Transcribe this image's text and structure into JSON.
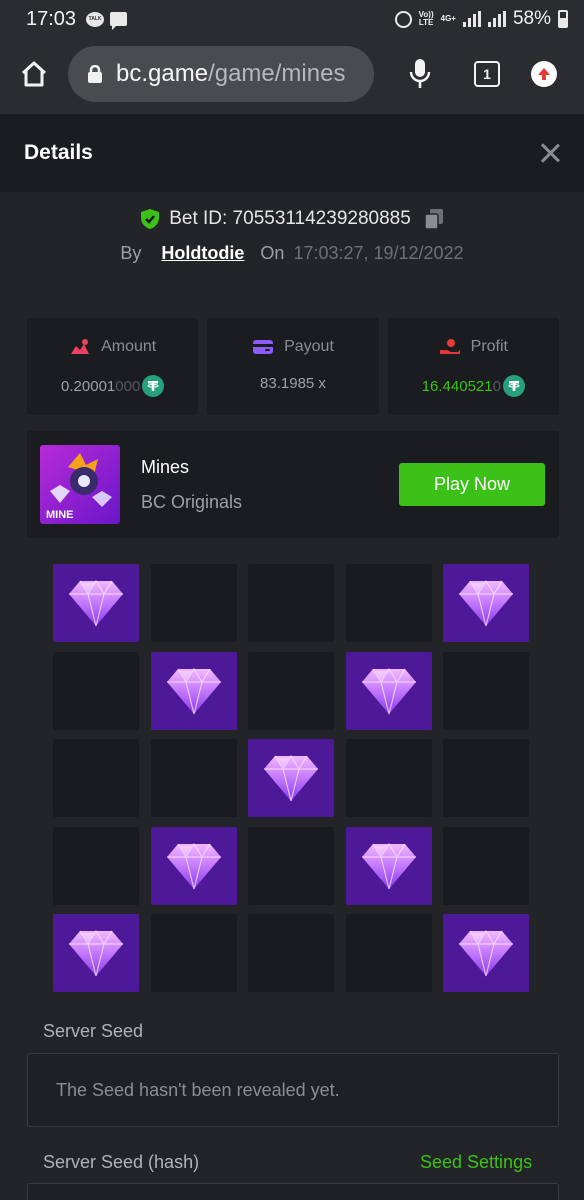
{
  "status_bar": {
    "time": "17:03",
    "network_top": "Vo))",
    "network_bottom": "LTE",
    "network_gen": "4G+",
    "battery": "58%"
  },
  "browser": {
    "url_host": "bc.game",
    "url_path": "/game/mines",
    "tab_count": "1"
  },
  "details": {
    "title": "Details"
  },
  "bet": {
    "id_text": "Bet ID: 70553114239280885",
    "by_label": "By",
    "user": "Holdtodie",
    "on_label": "On",
    "datetime": "17:03:27, 19/12/2022"
  },
  "stats": {
    "amount": {
      "label": "Amount",
      "value_main": "0.20001",
      "value_dim": "000",
      "icon_color": "#ed4163"
    },
    "payout": {
      "label": "Payout",
      "value": "83.1985 x",
      "icon_color": "#8b5cf6"
    },
    "profit": {
      "label": "Profit",
      "value_main": "16.440521",
      "value_dim": "0",
      "icon_color": "#e53935"
    }
  },
  "game": {
    "name": "Mines",
    "provider": "BC Originals",
    "thumb_label": "MINE",
    "play_label": "Play Now"
  },
  "grid": {
    "tiles": [
      "gem",
      "empty",
      "empty",
      "empty",
      "gem",
      "empty",
      "gem",
      "empty",
      "gem",
      "empty",
      "empty",
      "empty",
      "gem",
      "empty",
      "empty",
      "empty",
      "gem",
      "empty",
      "gem",
      "empty",
      "gem",
      "empty",
      "empty",
      "empty",
      "gem"
    ]
  },
  "seeds": {
    "server_seed_label": "Server Seed",
    "server_seed_value": "The Seed hasn't been revealed yet.",
    "server_hash_label": "Server Seed (hash)",
    "seed_settings_label": "Seed Settings"
  },
  "colors": {
    "accent_green": "#3bc117",
    "gem_tile": "#4d1999",
    "panel": "#1b1c1f",
    "background": "#232428"
  }
}
